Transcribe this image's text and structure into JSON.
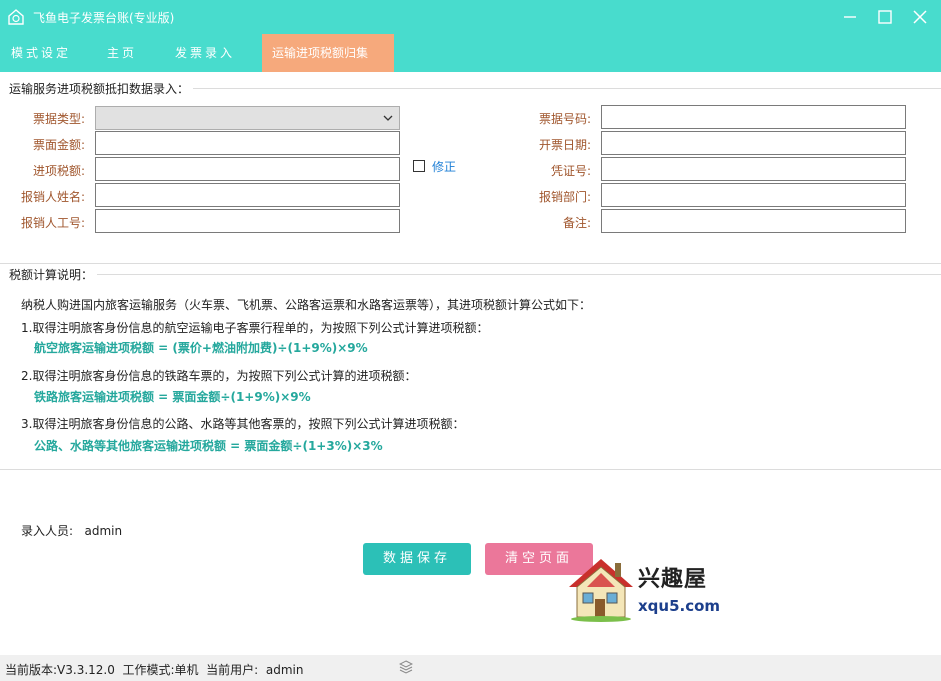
{
  "window": {
    "title": "飞鱼电子发票台账(专业版)",
    "accent_color": "#48dccd",
    "active_tab_color": "#f6a97c"
  },
  "menu": {
    "items": [
      {
        "label": "模式设定"
      },
      {
        "label": "主页"
      },
      {
        "label": "发票录入"
      },
      {
        "label": "运输进项税额归集"
      }
    ]
  },
  "form": {
    "section_title": "运输服务进项税额抵扣数据录入：",
    "left_fields": [
      {
        "label": "票据类型:",
        "value": "",
        "type": "select"
      },
      {
        "label": "票面金额:",
        "value": ""
      },
      {
        "label": "进项税额:",
        "value": ""
      },
      {
        "label": "报销人姓名:",
        "value": ""
      },
      {
        "label": "报销人工号:",
        "value": ""
      }
    ],
    "right_fields": [
      {
        "label": "票据号码:",
        "value": ""
      },
      {
        "label": "开票日期:",
        "value": ""
      },
      {
        "label": "凭证号:",
        "value": ""
      },
      {
        "label": "报销部门:",
        "value": ""
      },
      {
        "label": "备注:",
        "value": ""
      }
    ],
    "modify_checkbox": {
      "label": "修正",
      "checked": false
    }
  },
  "explanation": {
    "section_title": "税额计算说明：",
    "intro": "纳税人购进国内旅客运输服务（火车票、飞机票、公路客运票和水路客运票等），其进项税额计算公式如下：",
    "rules": [
      {
        "desc": "1.取得注明旅客身份信息的航空运输电子客票行程单的，为按照下列公式计算进项税额：",
        "formula": "航空旅客运输进项税额 = (票价+燃油附加费)÷(1+9%)×9%"
      },
      {
        "desc": "2.取得注明旅客身份信息的铁路车票的，为按照下列公式计算的进项税额：",
        "formula": "铁路旅客运输进项税额 = 票面金额÷(1+9%)×9%"
      },
      {
        "desc": "3.取得注明旅客身份信息的公路、水路等其他客票的，按照下列公式计算进项税额：",
        "formula": "公路、水路等其他旅客运输进项税额 = 票面金额÷(1+3%)×3%"
      }
    ]
  },
  "footer": {
    "operator_label": "录入人员:",
    "operator_value": "admin",
    "save_label": "数据保存",
    "clear_label": "清空页面"
  },
  "watermark": {
    "cn": "兴趣屋",
    "url": "xqu5.com"
  },
  "status": {
    "text": "当前版本:V3.3.12.0  工作模式:单机  当前用户:  admin",
    "icon": "layers-icon"
  }
}
